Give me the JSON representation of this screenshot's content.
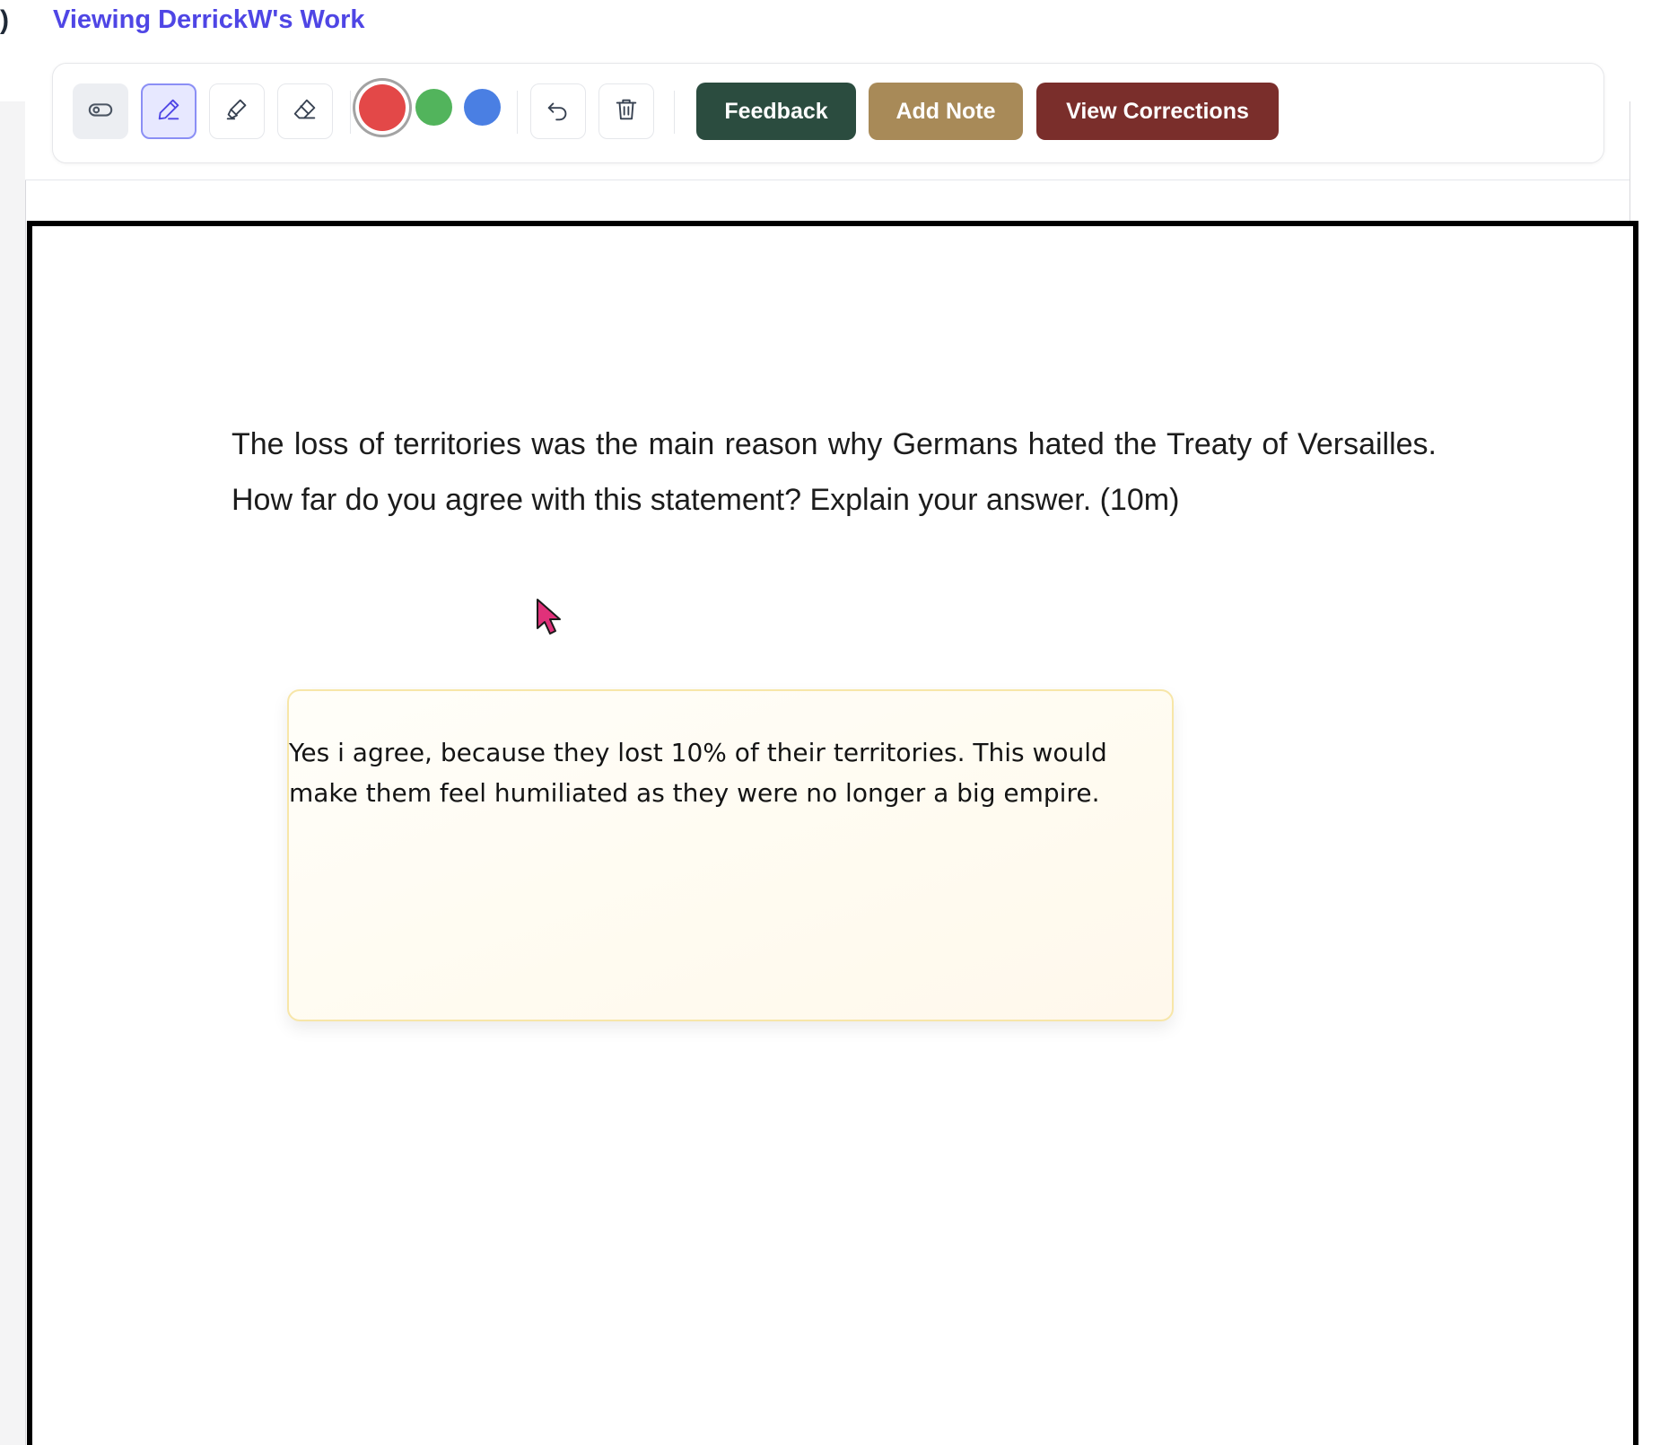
{
  "header": {
    "viewing_title": "Viewing DerrickW's Work",
    "left_edge_glyph": ")"
  },
  "toolbar": {
    "tools": [
      {
        "name": "mouse-mode",
        "icon": "toggle-icon",
        "selected": false
      },
      {
        "name": "pen",
        "icon": "pen-icon",
        "selected": true
      },
      {
        "name": "highlighter",
        "icon": "highlighter-icon",
        "selected": false
      },
      {
        "name": "eraser",
        "icon": "eraser-icon",
        "selected": false
      }
    ],
    "colors": [
      {
        "name": "red",
        "hex": "#e34848",
        "selected": true
      },
      {
        "name": "green",
        "hex": "#52b45c",
        "selected": false
      },
      {
        "name": "blue",
        "hex": "#4a7fe3",
        "selected": false
      }
    ],
    "undo_icon": "undo-icon",
    "delete_icon": "trash-icon",
    "feedback_label": "Feedback",
    "feedback_color": "#2b4c3f",
    "add_note_label": "Add Note",
    "add_note_color": "#a88a58",
    "view_corrections_label": "View Corrections",
    "view_corrections_color": "#7a2e2b",
    "accent_color": "#4f46e5"
  },
  "document": {
    "question": "The loss of territories was the main reason why Germans hated the Treaty of Versailles. How far do you agree with this statement? Explain your answer. (10m)",
    "answer": "Yes i agree, because they lost 10% of their territories. This would make them feel humiliated as they were no longer a big empire."
  }
}
